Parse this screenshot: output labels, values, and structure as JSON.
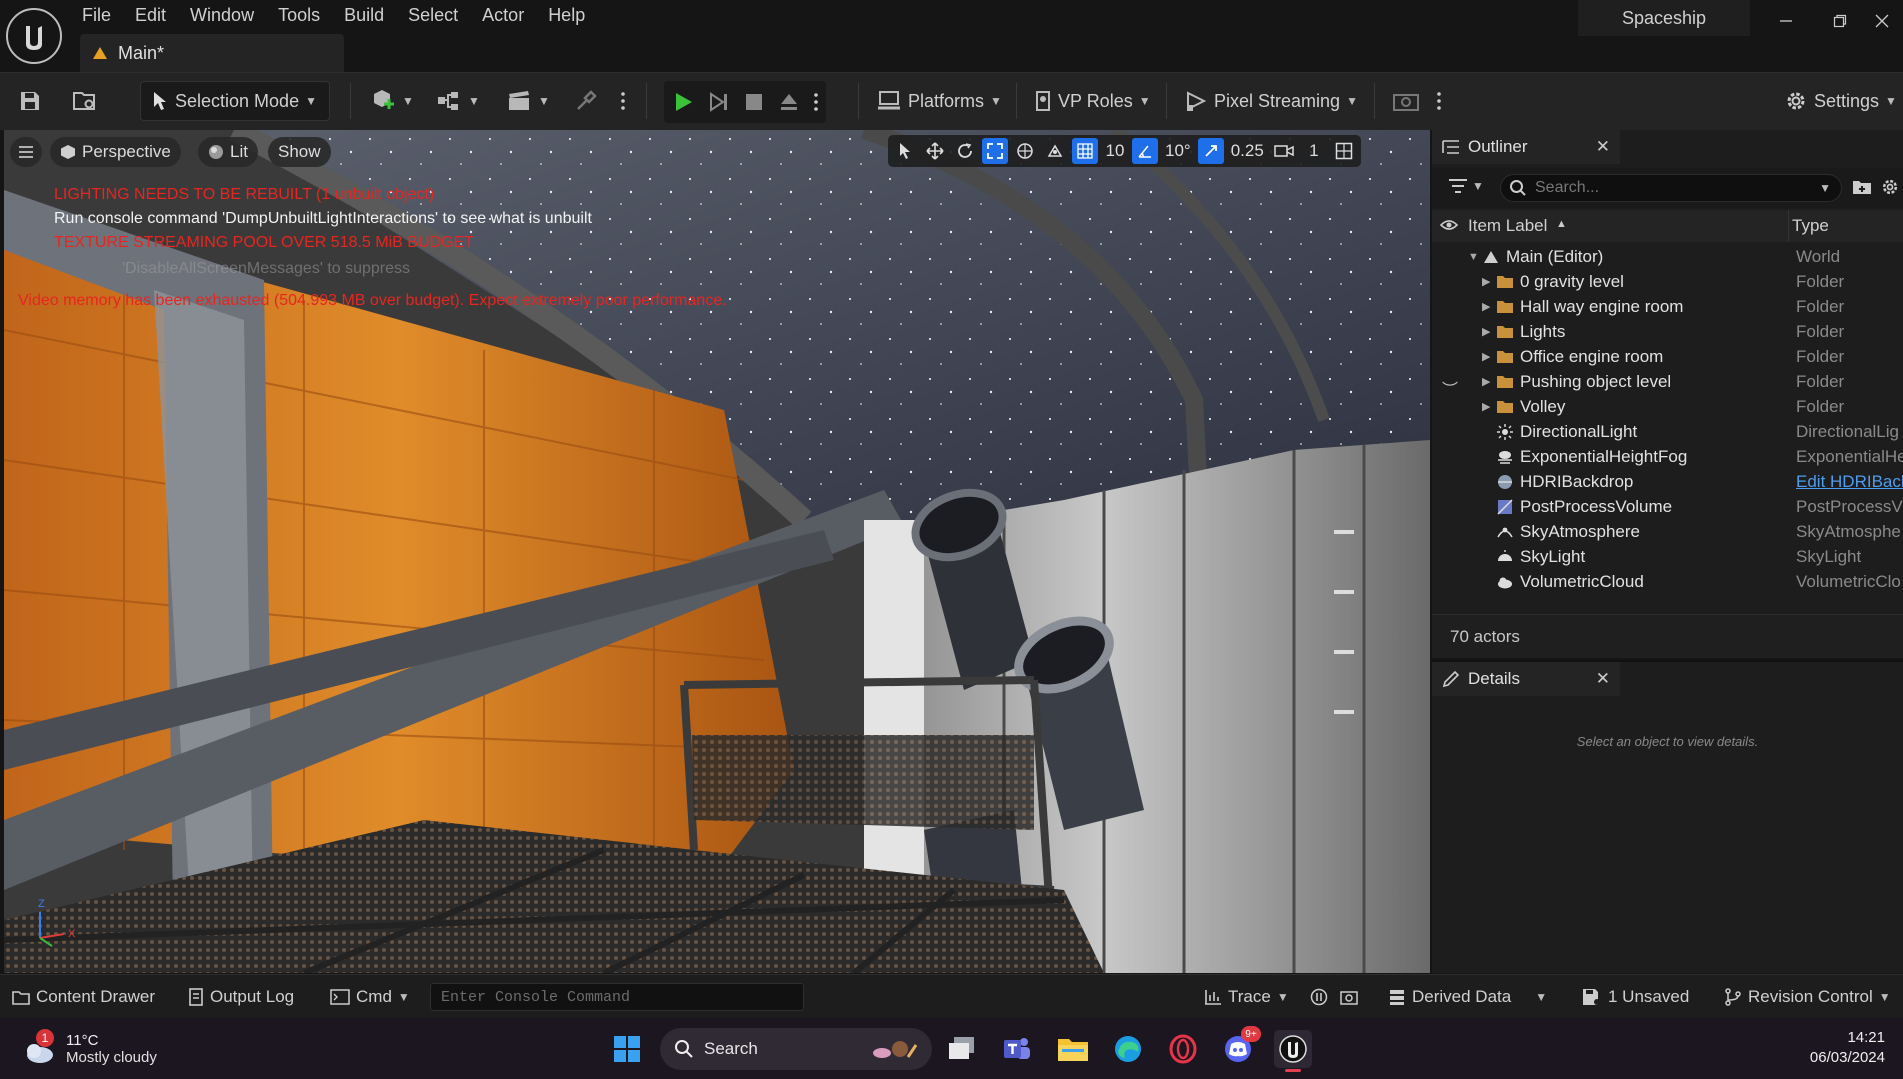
{
  "menu": [
    "File",
    "Edit",
    "Window",
    "Tools",
    "Build",
    "Select",
    "Actor",
    "Help"
  ],
  "document_tab": "Main*",
  "project_name": "Spaceship",
  "toolbar": {
    "selection_mode": "Selection Mode",
    "platforms": "Platforms",
    "vp_roles": "VP Roles",
    "pixel_streaming": "Pixel Streaming",
    "settings": "Settings"
  },
  "viewport": {
    "perspective": "Perspective",
    "lit": "Lit",
    "show": "Show",
    "grid_snap": "10",
    "rotation_snap": "10°",
    "scale_snap": "0.25",
    "camera_speed": "1",
    "messages": {
      "lighting": "LIGHTING NEEDS TO BE REBUILT (1 unbuilt object)",
      "console_hint": "Run console command 'DumpUnbuiltLightInteractions' to see what is unbuilt",
      "texture_pool": "TEXTURE STREAMING POOL OVER 518.5 MiB BUDGET",
      "disable_hint": "'DisableAllScreenMessages' to suppress",
      "video_memory": "Video memory has been exhausted (504.993 MB over budget). Expect extremely poor performance."
    },
    "axis_x": "X",
    "axis_z": "Z"
  },
  "outliner": {
    "title": "Outliner",
    "search_placeholder": "Search...",
    "col_label": "Item Label",
    "col_type": "Type",
    "items": [
      {
        "label": "Main (Editor)",
        "type": "World",
        "icon": "world-icon",
        "level": 0,
        "arrow": "open"
      },
      {
        "label": "0 gravity level",
        "type": "Folder",
        "icon": "folder-icon",
        "level": 1,
        "arrow": "closed"
      },
      {
        "label": "Hall way engine room",
        "type": "Folder",
        "icon": "folder-icon",
        "level": 1,
        "arrow": "closed"
      },
      {
        "label": "Lights",
        "type": "Folder",
        "icon": "folder-icon",
        "level": 1,
        "arrow": "closed"
      },
      {
        "label": "Office engine room",
        "type": "Folder",
        "icon": "folder-icon",
        "level": 1,
        "arrow": "closed"
      },
      {
        "label": "Pushing object level",
        "type": "Folder",
        "icon": "folder-icon",
        "level": 1,
        "arrow": "closed"
      },
      {
        "label": "Volley",
        "type": "Folder",
        "icon": "folder-icon",
        "level": 1,
        "arrow": "closed"
      },
      {
        "label": "DirectionalLight",
        "type": "DirectionalLig",
        "icon": "directional-light-icon",
        "level": 1,
        "arrow": "none"
      },
      {
        "label": "ExponentialHeightFog",
        "type": "ExponentialHe",
        "icon": "fog-icon",
        "level": 1,
        "arrow": "none"
      },
      {
        "label": "HDRIBackdrop",
        "type": "Edit HDRIBacl",
        "icon": "hdri-icon",
        "level": 1,
        "arrow": "none",
        "type_link": true
      },
      {
        "label": "PostProcessVolume",
        "type": "PostProcessV",
        "icon": "post-process-icon",
        "level": 1,
        "arrow": "none"
      },
      {
        "label": "SkyAtmosphere",
        "type": "SkyAtmosphe",
        "icon": "sky-atmosphere-icon",
        "level": 1,
        "arrow": "none"
      },
      {
        "label": "SkyLight",
        "type": "SkyLight",
        "icon": "skylight-icon",
        "level": 1,
        "arrow": "none"
      },
      {
        "label": "VolumetricCloud",
        "type": "VolumetricClo",
        "icon": "cloud-icon",
        "level": 1,
        "arrow": "none"
      }
    ],
    "actor_count": "70 actors"
  },
  "details": {
    "title": "Details",
    "empty_message": "Select an object to view details."
  },
  "statusbar": {
    "content_drawer": "Content Drawer",
    "output_log": "Output Log",
    "cmd": "Cmd",
    "console_placeholder": "Enter Console Command",
    "trace": "Trace",
    "derived_data": "Derived Data",
    "unsaved": "1 Unsaved",
    "revision_control": "Revision Control"
  },
  "taskbar": {
    "temperature": "11°C",
    "weather": "Mostly cloudy",
    "weather_badge": "1",
    "search": "Search",
    "discord_badge": "9+",
    "time": "14:21",
    "date": "06/03/2024"
  },
  "colors": {
    "accent_blue": "#1f6feb",
    "play_green": "#3cc13b",
    "error_red": "#e8251f",
    "orange_wall": "#d8781f"
  }
}
